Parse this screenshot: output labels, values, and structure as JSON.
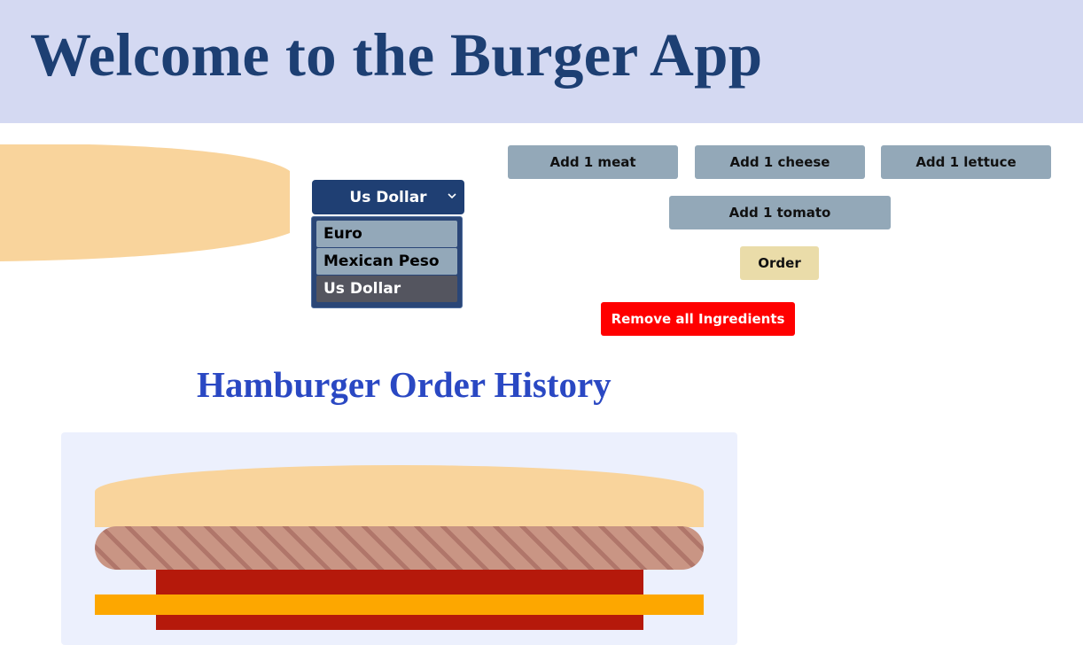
{
  "header": {
    "title": "Welcome to the Burger App"
  },
  "currency": {
    "selected": "Us Dollar",
    "options": [
      "Euro",
      "Mexican Peso",
      "Us Dollar"
    ]
  },
  "buttons": {
    "add_meat": "Add 1 meat",
    "add_cheese": "Add 1 cheese",
    "add_lettuce": "Add 1 lettuce",
    "add_tomato": "Add 1 tomato",
    "order": "Order",
    "remove_all": "Remove all Ingredients"
  },
  "history": {
    "title": "Hamburger Order History"
  },
  "colors": {
    "header_bg": "#d4d9f2",
    "title": "#1d3f73",
    "bun": "#f9d49c",
    "meat": "#c99584",
    "tomato": "#b5190b",
    "cheese": "#fda700",
    "remove_button": "#ff0000",
    "order_button": "#eadca9",
    "add_button": "#93a8b8"
  }
}
